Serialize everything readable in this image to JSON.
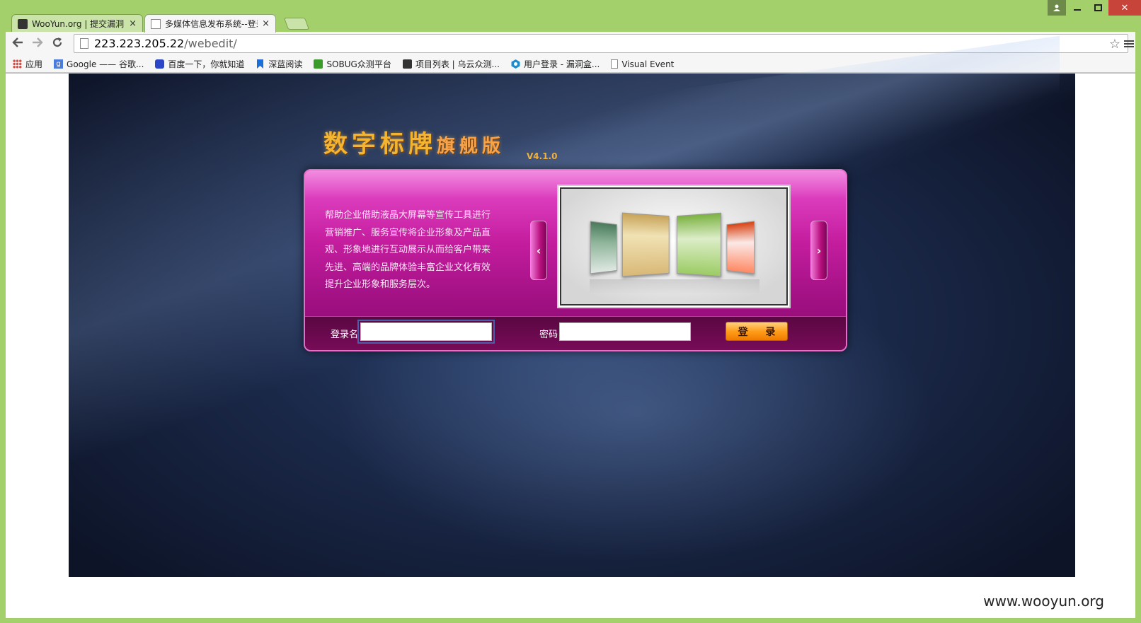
{
  "browser": {
    "tabs": [
      {
        "label": "WooYun.org | 提交漏洞",
        "close": "×"
      },
      {
        "label": "多媒体信息发布系统--登录",
        "close": "×"
      }
    ],
    "window_close": "✕",
    "url_host": "223.223.205.22",
    "url_path": "/webedit/",
    "bookmarks": [
      {
        "label": "应用",
        "icon": "apps-grid-icon",
        "color": "#e0453a"
      },
      {
        "label": "Google —— 谷歌...",
        "icon": "google-icon",
        "color": "#4a7ddb"
      },
      {
        "label": "百度一下，你就知道",
        "icon": "baidu-icon",
        "color": "#2b46c6"
      },
      {
        "label": "深蓝阅读",
        "icon": "bookmark-flag-icon",
        "color": "#1c6fd8"
      },
      {
        "label": "SOBUG众测平台",
        "icon": "sobug-icon",
        "color": "#3a9a2a"
      },
      {
        "label": "项目列表 | 乌云众测...",
        "icon": "wooyun-icon",
        "color": "#333333"
      },
      {
        "label": "用户登录 - 漏洞盒...",
        "icon": "hexagon-icon",
        "color": "#1a8fd0"
      },
      {
        "label": "Visual Event",
        "icon": "page-icon",
        "color": "#888888"
      }
    ]
  },
  "page": {
    "logo_main": "数字标牌",
    "logo_sub": "旗舰版",
    "version": "V4.1.0",
    "description": "帮助企业借助液晶大屏幕等宣传工具进行营销推广、服务宣传将企业形象及产品直观、形象地进行互动展示从而给客户带来先进、高端的品牌体验丰富企业文化有效提升企业形象和服务层次。",
    "prev_arrow": "‹",
    "next_arrow": "›",
    "login_label": "登录名",
    "password_label": "密码",
    "login_button": "登 录",
    "login_value": "",
    "password_value": ""
  },
  "watermark": "www.wooyun.org",
  "colors": {
    "chrome_frame": "#a3d06a",
    "panel_magenta": "#c41d9e",
    "login_button": "#ff9d1a",
    "logo_gold": "#f3b531"
  }
}
